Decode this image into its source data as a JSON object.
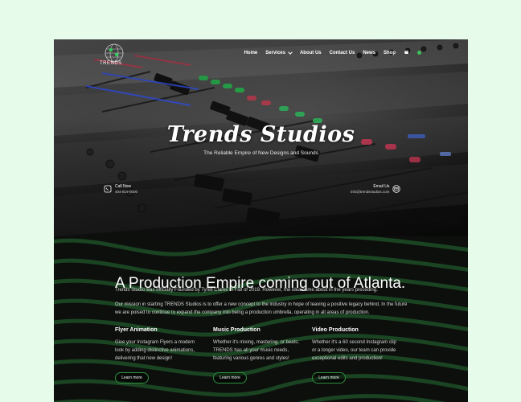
{
  "site": {
    "logo_text": "TRENDS",
    "nav": [
      {
        "label": "Home"
      },
      {
        "label": "Services"
      },
      {
        "label": "About Us"
      },
      {
        "label": "Contact Us"
      },
      {
        "label": "News"
      },
      {
        "label": "Shop"
      }
    ],
    "cart_icon": "cart-icon"
  },
  "hero": {
    "title": "Trends Studios",
    "subtitle": "The Reliable Empire of New Designs and Sounds",
    "call": {
      "label": "Call Now",
      "value": "404-819-0000",
      "icon": "phone-icon"
    },
    "email": {
      "label": "Email Us",
      "value": "info@trendsstudios.com",
      "icon": "email-icon"
    }
  },
  "about": {
    "title": "A Production Empire coming out of Atlanta.",
    "para1": "Trends Studio was officially Founded by Tyrell Clarke in Fall of 2019. However, the idea came about in the years preceding.",
    "para2": "Our mission in starting TRENDS Studios is to offer a new concept to the industry in hope of leaving a positive legacy behind. In the future we are poised to continue to expand the company into being a production umbrella, operating in all areas of production.",
    "columns": [
      {
        "title": "Flyer Animation",
        "text": "Give your Instagram Flyers a modern look by adding distinctive animations, delivering that new design!",
        "button": "Learn more"
      },
      {
        "title": "Music Production",
        "text": "Whether it's mixing, mastering, or beats; TRENDS has all your music needs, featuring various genres and styles!",
        "button": "Learn more"
      },
      {
        "title": "Video Production",
        "text": "Whether it's a 60 second Instagram clip or a longer video, our team can provide exceptional edits and production!",
        "button": "Learn more"
      }
    ]
  },
  "colors": {
    "page_bg": "#e6fbe9",
    "accent": "#2f8f3f",
    "dark_bg": "#0d0f0d"
  }
}
